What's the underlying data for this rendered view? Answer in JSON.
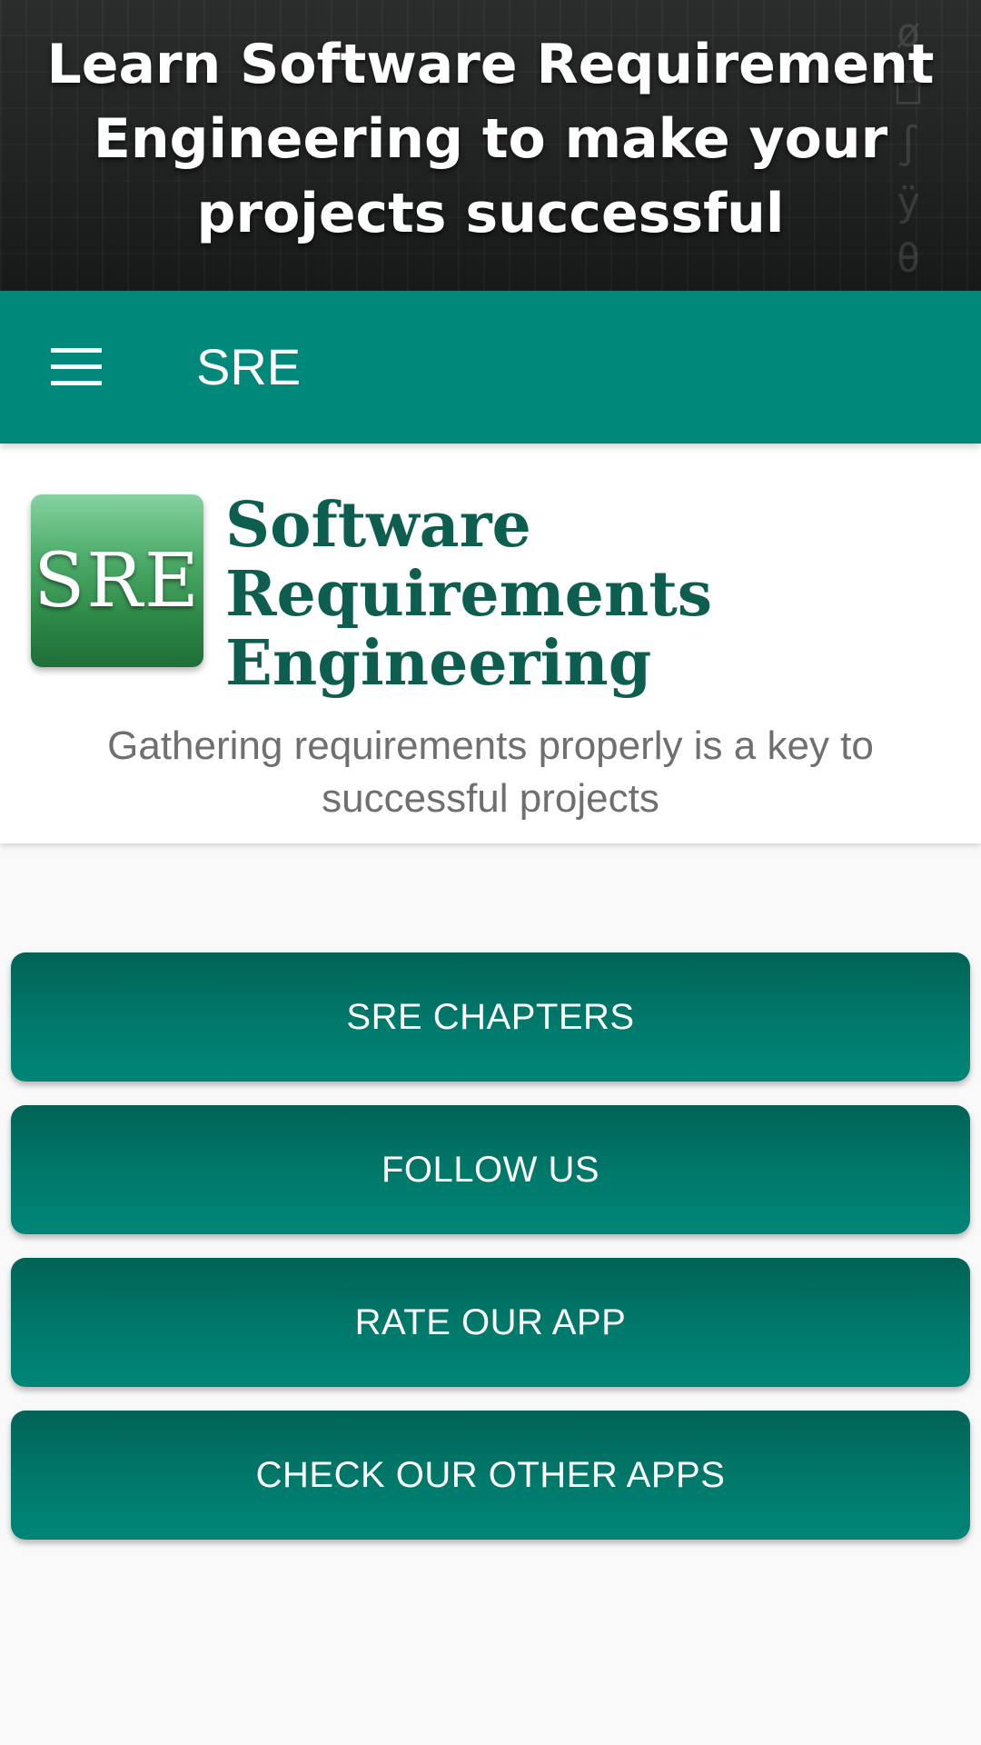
{
  "banner": {
    "title": "Learn Software Requirement Engineering to make your projects successful"
  },
  "toolbar": {
    "title": "SRE",
    "menu_icon": "hamburger-menu-icon",
    "color": "#00897b"
  },
  "header": {
    "logo_text": "SRE",
    "app_name": "Software Requirements Engineering",
    "tagline": "Gathering requirements properly is a key to successful projects"
  },
  "actions": [
    {
      "label": "SRE CHAPTERS"
    },
    {
      "label": "FOLLOW US"
    },
    {
      "label": "RATE OUR APP"
    },
    {
      "label": "CHECK OUR OTHER APPS"
    }
  ],
  "colors": {
    "accent": "#00897b",
    "button": "#00796b",
    "heading": "#0d5e4f",
    "background": "#f9f9f9"
  }
}
